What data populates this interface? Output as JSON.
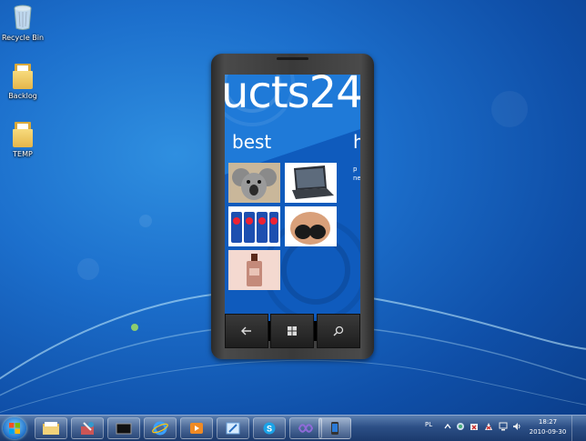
{
  "desktop": {
    "icons": [
      {
        "label": "Recycle Bin",
        "icon": "recycle-bin-icon"
      },
      {
        "label": "Backlog",
        "icon": "folder-icon"
      },
      {
        "label": "TEMP",
        "icon": "folder-icon"
      }
    ]
  },
  "phone": {
    "panorama_title": "ucts24",
    "section_title": "best",
    "next_section_title": "h",
    "side_text": [
      "p",
      "ne"
    ],
    "tiles": [
      {
        "icon": "koala-image"
      },
      {
        "icon": "laptop-image"
      },
      {
        "icon": "cans-image"
      },
      {
        "icon": "swimsuit-image"
      },
      {
        "icon": "perfume-image"
      }
    ],
    "buttons": [
      {
        "icon": "back-arrow-icon"
      },
      {
        "icon": "windows-start-icon"
      },
      {
        "icon": "search-icon"
      }
    ]
  },
  "taskbar": {
    "apps": [
      {
        "icon": "windows-explorer-icon"
      },
      {
        "icon": "tools-icon"
      },
      {
        "icon": "terminal-icon"
      },
      {
        "icon": "internet-explorer-icon"
      },
      {
        "icon": "media-player-icon"
      },
      {
        "icon": "blend-icon"
      },
      {
        "icon": "skype-icon"
      },
      {
        "icon": "visual-studio-icon"
      },
      {
        "icon": "phone-emulator-icon"
      }
    ],
    "language": "PL",
    "time": "18:27",
    "date": "2010-09-30"
  },
  "colors": {
    "desktop_blue": "#1c6fcc",
    "phone_accent": "#1466c8",
    "taskbar": "#2c4f86"
  }
}
